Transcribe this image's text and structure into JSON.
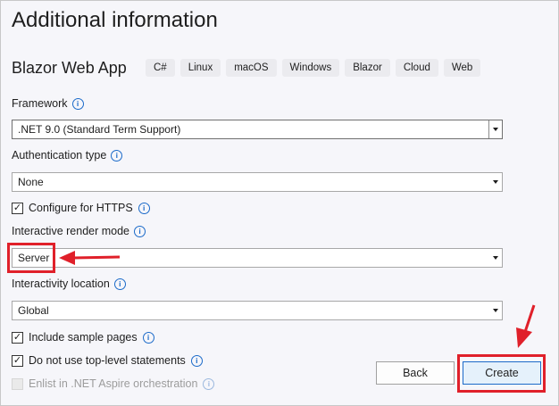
{
  "header": {
    "title": "Additional information",
    "template_name": "Blazor Web App",
    "tags": [
      "C#",
      "Linux",
      "macOS",
      "Windows",
      "Blazor",
      "Cloud",
      "Web"
    ]
  },
  "form": {
    "framework": {
      "label": "Framework",
      "value": ".NET 9.0 (Standard Term Support)"
    },
    "authentication": {
      "label": "Authentication type",
      "value": "None"
    },
    "configure_https": {
      "label": "Configure for HTTPS",
      "checked": true
    },
    "render_mode": {
      "label": "Interactive render mode",
      "value": "Server"
    },
    "interactivity_location": {
      "label": "Interactivity location",
      "value": "Global"
    },
    "include_sample_pages": {
      "label": "Include sample pages",
      "checked": true
    },
    "no_top_level_statements": {
      "label": "Do not use top-level statements",
      "checked": true
    },
    "enlist_aspire": {
      "label": "Enlist in .NET Aspire orchestration",
      "checked": false,
      "disabled": true
    }
  },
  "buttons": {
    "back": "Back",
    "create": "Create"
  },
  "icons": {
    "info": "info-icon",
    "checkmark": "✓",
    "annotation_color": "#e0202a",
    "accent": "#1b6ac9"
  }
}
